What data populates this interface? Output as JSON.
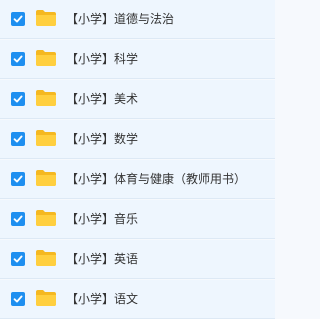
{
  "theme": {
    "checkbox_color": "#1e8ff0",
    "folder_color": "#ffc933"
  },
  "items": [
    {
      "name": "【小学】道德与法治",
      "checked": true,
      "icon": "folder-icon"
    },
    {
      "name": "【小学】科学",
      "checked": true,
      "icon": "folder-icon"
    },
    {
      "name": "【小学】美术",
      "checked": true,
      "icon": "folder-icon"
    },
    {
      "name": "【小学】数学",
      "checked": true,
      "icon": "folder-icon"
    },
    {
      "name": "【小学】体育与健康（教师用书）",
      "checked": true,
      "icon": "folder-icon"
    },
    {
      "name": "【小学】音乐",
      "checked": true,
      "icon": "folder-icon"
    },
    {
      "name": "【小学】英语",
      "checked": true,
      "icon": "folder-icon"
    },
    {
      "name": "【小学】语文",
      "checked": true,
      "icon": "folder-icon"
    }
  ]
}
